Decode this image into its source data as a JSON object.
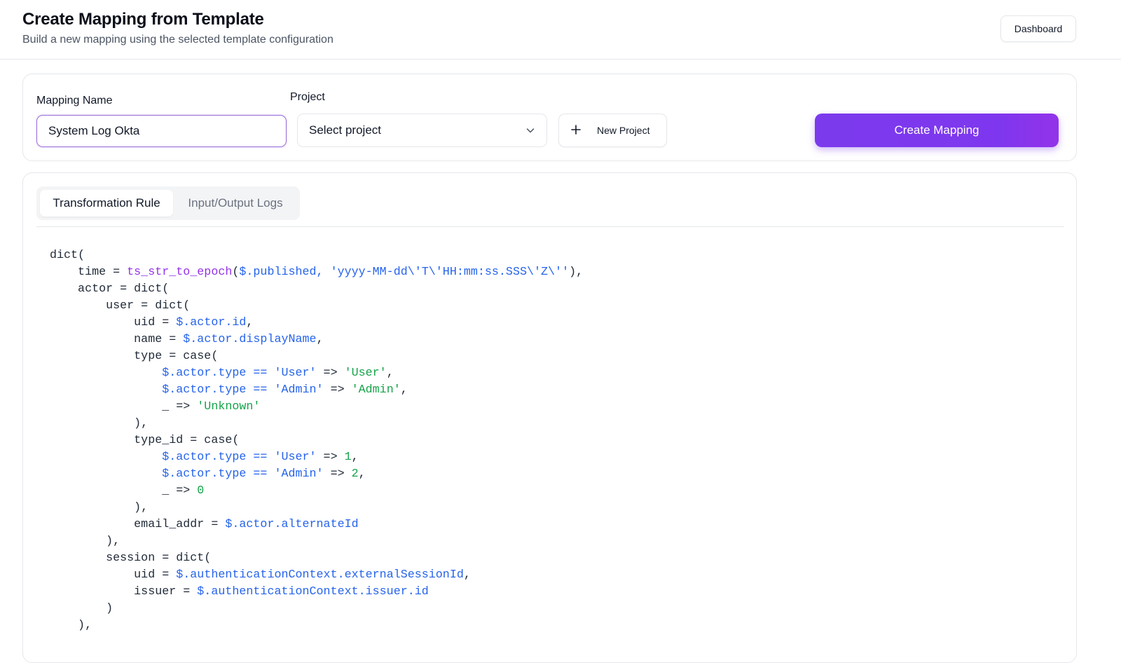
{
  "header": {
    "title": "Create Mapping from Template",
    "subtitle": "Build a new mapping using the selected template configuration",
    "dashboard_label": "Dashboard"
  },
  "form": {
    "mapping_name_label": "Mapping Name",
    "mapping_name_value": "System Log Okta",
    "project_label": "Project",
    "project_placeholder": "Select project",
    "new_project_label": "New Project",
    "create_mapping_label": "Create Mapping"
  },
  "tabs": [
    {
      "label": "Transformation Rule",
      "active": true
    },
    {
      "label": "Input/Output Logs",
      "active": false
    }
  ],
  "colors": {
    "accent": "#7c3aed",
    "function": "#9333ea",
    "path": "#2563eb",
    "string": "#16a34a"
  },
  "icons": {
    "project_dropdown": "chevron-down-icon",
    "new_project": "plus-icon"
  },
  "code_lines": [
    [
      {
        "t": "dict(",
        "k": "plain"
      }
    ],
    [
      {
        "t": "    time = ",
        "k": "plain"
      },
      {
        "t": "ts_str_to_epoch",
        "k": "func"
      },
      {
        "t": "(",
        "k": "plain"
      },
      {
        "t": "$.published, 'yyyy-MM-dd\\'T\\'HH:mm:ss.SSS\\'Z\\''",
        "k": "path"
      },
      {
        "t": "),",
        "k": "plain"
      }
    ],
    [
      {
        "t": "    actor = dict(",
        "k": "plain"
      }
    ],
    [
      {
        "t": "        user = dict(",
        "k": "plain"
      }
    ],
    [
      {
        "t": "            uid = ",
        "k": "plain"
      },
      {
        "t": "$.actor.id",
        "k": "path"
      },
      {
        "t": ",",
        "k": "plain"
      }
    ],
    [
      {
        "t": "            name = ",
        "k": "plain"
      },
      {
        "t": "$.actor.displayName",
        "k": "path"
      },
      {
        "t": ",",
        "k": "plain"
      }
    ],
    [
      {
        "t": "            type = case(",
        "k": "plain"
      }
    ],
    [
      {
        "t": "                ",
        "k": "plain"
      },
      {
        "t": "$.actor.type == 'User'",
        "k": "path"
      },
      {
        "t": " => ",
        "k": "plain"
      },
      {
        "t": "'User'",
        "k": "str"
      },
      {
        "t": ",",
        "k": "plain"
      }
    ],
    [
      {
        "t": "                ",
        "k": "plain"
      },
      {
        "t": "$.actor.type == 'Admin'",
        "k": "path"
      },
      {
        "t": " => ",
        "k": "plain"
      },
      {
        "t": "'Admin'",
        "k": "str"
      },
      {
        "t": ",",
        "k": "plain"
      }
    ],
    [
      {
        "t": "                _ => ",
        "k": "plain"
      },
      {
        "t": "'Unknown'",
        "k": "str"
      }
    ],
    [
      {
        "t": "            ),",
        "k": "plain"
      }
    ],
    [
      {
        "t": "            type_id = case(",
        "k": "plain"
      }
    ],
    [
      {
        "t": "                ",
        "k": "plain"
      },
      {
        "t": "$.actor.type == 'User'",
        "k": "path"
      },
      {
        "t": " => ",
        "k": "plain"
      },
      {
        "t": "1",
        "k": "num"
      },
      {
        "t": ",",
        "k": "plain"
      }
    ],
    [
      {
        "t": "                ",
        "k": "plain"
      },
      {
        "t": "$.actor.type == 'Admin'",
        "k": "path"
      },
      {
        "t": " => ",
        "k": "plain"
      },
      {
        "t": "2",
        "k": "num"
      },
      {
        "t": ",",
        "k": "plain"
      }
    ],
    [
      {
        "t": "                _ => ",
        "k": "plain"
      },
      {
        "t": "0",
        "k": "num"
      }
    ],
    [
      {
        "t": "            ),",
        "k": "plain"
      }
    ],
    [
      {
        "t": "            email_addr = ",
        "k": "plain"
      },
      {
        "t": "$.actor.alternateId",
        "k": "path"
      }
    ],
    [
      {
        "t": "        ),",
        "k": "plain"
      }
    ],
    [
      {
        "t": "        session = dict(",
        "k": "plain"
      }
    ],
    [
      {
        "t": "            uid = ",
        "k": "plain"
      },
      {
        "t": "$.authenticationContext.externalSessionId",
        "k": "path"
      },
      {
        "t": ",",
        "k": "plain"
      }
    ],
    [
      {
        "t": "            issuer = ",
        "k": "plain"
      },
      {
        "t": "$.authenticationContext.issuer.id",
        "k": "path"
      }
    ],
    [
      {
        "t": "        )",
        "k": "plain"
      }
    ],
    [
      {
        "t": "    ),",
        "k": "plain"
      }
    ]
  ]
}
